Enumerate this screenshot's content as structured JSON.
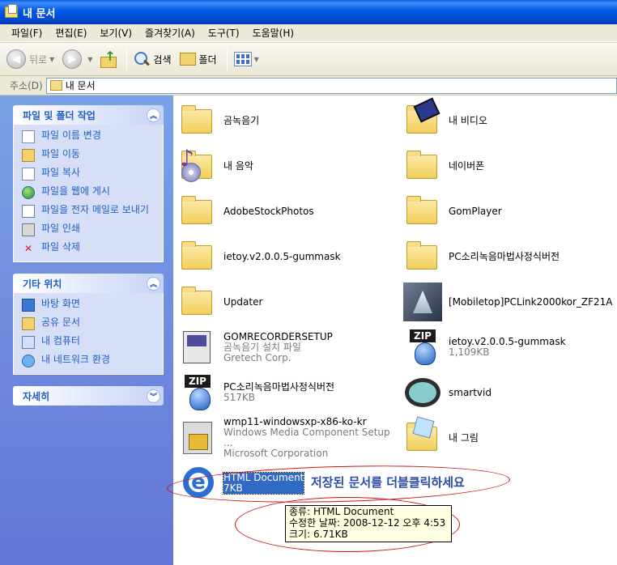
{
  "window": {
    "title": "내 문서"
  },
  "menu": [
    "파일(F)",
    "편집(E)",
    "보기(V)",
    "즐겨찾기(A)",
    "도구(T)",
    "도움말(H)"
  ],
  "toolbar": {
    "back": "뒤로",
    "search": "검색",
    "folders": "폴더"
  },
  "address": {
    "label": "주소(D)",
    "value": "내 문서"
  },
  "panels": {
    "tasks": {
      "title": "파일 및 폴더 작업",
      "items": [
        "파일 이름 변경",
        "파일 이동",
        "파일 복사",
        "파일을 웹에 게시",
        "파일을 전자 메일로 보내기",
        "파일 인쇄",
        "파일 삭제"
      ]
    },
    "places": {
      "title": "기타 위치",
      "items": [
        "바탕 화면",
        "공유 문서",
        "내 컴퓨터",
        "내 네트워크 환경"
      ]
    },
    "details": {
      "title": "자세히"
    }
  },
  "files": [
    {
      "name": "곰녹음기",
      "sub1": "",
      "sub2": "",
      "icon": "folder-icon"
    },
    {
      "name": "내 비디오",
      "sub1": "",
      "sub2": "",
      "icon": "video-folder-icon"
    },
    {
      "name": "내 음악",
      "sub1": "",
      "sub2": "",
      "icon": "music-folder-icon"
    },
    {
      "name": "네이버폰",
      "sub1": "",
      "sub2": "",
      "icon": "folder-icon"
    },
    {
      "name": "AdobeStockPhotos",
      "sub1": "",
      "sub2": "",
      "icon": "folder-icon"
    },
    {
      "name": "GomPlayer",
      "sub1": "",
      "sub2": "",
      "icon": "folder-icon"
    },
    {
      "name": "ietoy.v2.0.0.5-gummask",
      "sub1": "",
      "sub2": "",
      "icon": "folder-icon"
    },
    {
      "name": "PC소리녹음마법사정식버전",
      "sub1": "",
      "sub2": "",
      "icon": "folder-icon"
    },
    {
      "name": "Updater",
      "sub1": "",
      "sub2": "",
      "icon": "folder-icon"
    },
    {
      "name": "[Mobiletop]PCLink2000kor_ZF21A",
      "sub1": "",
      "sub2": "",
      "icon": "mobile-app-icon"
    },
    {
      "name": "GOMRECORDERSETUP",
      "sub1": "곰녹음기 설치 파일",
      "sub2": "Gretech Corp.",
      "icon": "setup-icon"
    },
    {
      "name": "ietoy.v2.0.0.5-gummask",
      "sub1": "1,109KB",
      "sub2": "",
      "icon": "zip-icon"
    },
    {
      "name": "PC소리녹음마법사정식버전",
      "sub1": "517KB",
      "sub2": "",
      "icon": "zip-icon"
    },
    {
      "name": "smartvid",
      "sub1": "",
      "sub2": "",
      "icon": "film-icon"
    },
    {
      "name": "wmp11-windowsxp-x86-ko-kr",
      "sub1": "Windows Media Component Setup ...",
      "sub2": "Microsoft Corporation",
      "icon": "installer-icon"
    },
    {
      "name": "내 그림",
      "sub1": "",
      "sub2": "",
      "icon": "picture-folder-icon"
    },
    {
      "name": "HTML Document",
      "sub1": "7KB",
      "sub2": "",
      "icon": "ie-document-icon"
    }
  ],
  "tooltip": {
    "type": "종류: HTML Document",
    "modified": "수정한 날짜: 2008-12-12 오후 4:53",
    "size": "크기: 6.71KB"
  },
  "annotation": "저장된 문서를 더블클릭하세요",
  "colors": {
    "title": "#0058e6",
    "task_link": "#215dc6",
    "annotation": "#2a4aa8",
    "circle": "#d01212",
    "selection": "#316ac5"
  }
}
